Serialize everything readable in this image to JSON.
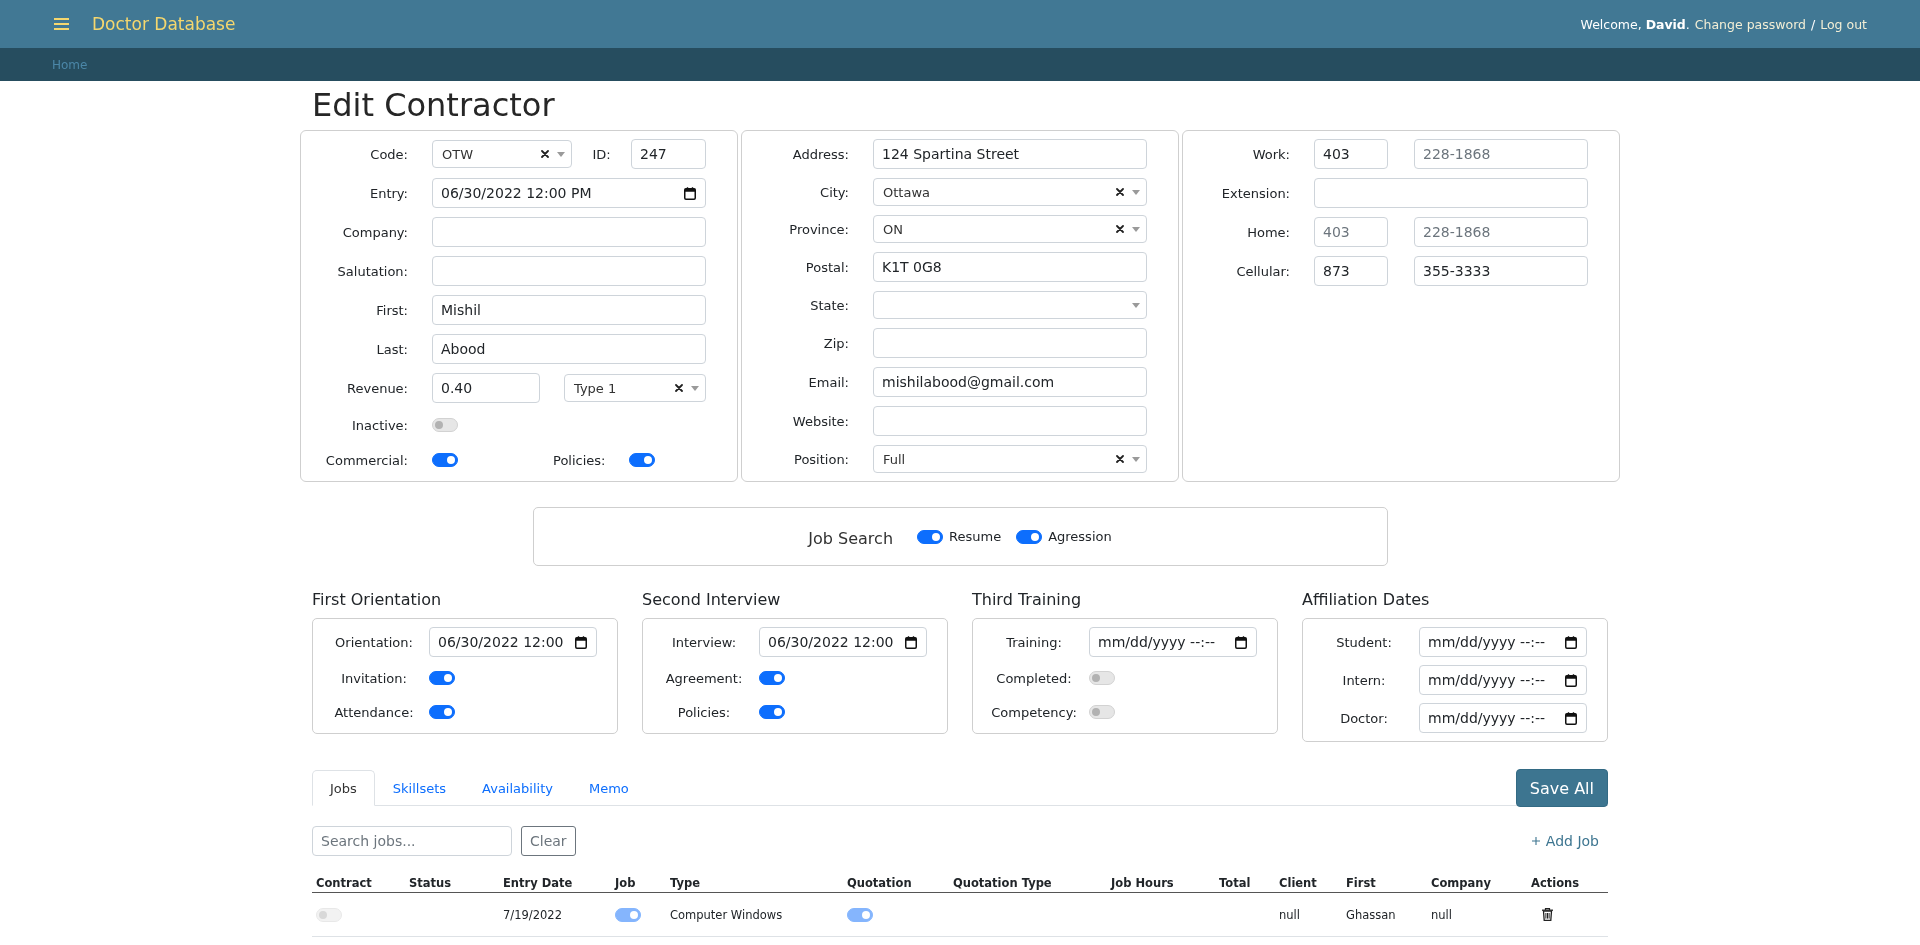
{
  "top_bar": {
    "title": "Doctor Database",
    "user_menu": [
      {
        "kind": "greeting",
        "text": "Welcome, **David**."
      },
      {
        "kind": "link",
        "text": "Change password"
      },
      {
        "kind": "separator",
        "text": "/"
      },
      {
        "kind": "link",
        "text": "Log out"
      }
    ]
  },
  "breadcrumb": [
    "Home"
  ],
  "page_title": "Edit Contractor",
  "main_cards": [
    {
      "rows": [
        {
          "label": "Code:",
          "controls": [
            {
              "kind": "select",
              "value": "OTW",
              "clearable": true
            },
            {
              "kind": "label",
              "text": "ID:"
            },
            {
              "kind": "text",
              "value": "247"
            }
          ]
        },
        {
          "label": "Entry:",
          "controls": [
            {
              "kind": "datetime",
              "value": "06/30/2022 12:00 PM"
            }
          ]
        },
        {
          "label": "Company:",
          "controls": [
            {
              "kind": "text"
            }
          ]
        },
        {
          "label": "Salutation:",
          "controls": [
            {
              "kind": "text"
            }
          ]
        },
        {
          "label": "First:",
          "controls": [
            {
              "kind": "text",
              "value": "Mishil"
            }
          ]
        },
        {
          "label": "Last:",
          "controls": [
            {
              "kind": "text",
              "value": "Abood"
            }
          ]
        },
        {
          "label": "Revenue:",
          "controls": [
            {
              "kind": "text",
              "value": "0.40"
            },
            {
              "kind": "select",
              "value": "Type 1",
              "clearable": true
            }
          ]
        },
        {
          "label": "Inactive:",
          "controls": [
            {
              "kind": "switch",
              "on": false
            }
          ]
        },
        {
          "label": "Commercial:",
          "controls": [
            {
              "kind": "switch",
              "on": true
            },
            {
              "kind": "label",
              "text": "Policies:"
            },
            {
              "kind": "switch",
              "on": true
            }
          ]
        }
      ]
    },
    {
      "rows": [
        {
          "label": "Address:",
          "controls": [
            {
              "kind": "text",
              "value": "124 Spartina Street"
            }
          ]
        },
        {
          "label": "City:",
          "controls": [
            {
              "kind": "select",
              "value": "Ottawa",
              "clearable": true
            }
          ]
        },
        {
          "label": "Province:",
          "controls": [
            {
              "kind": "select",
              "value": "ON",
              "clearable": true
            }
          ]
        },
        {
          "label": "Postal:",
          "controls": [
            {
              "kind": "text",
              "value": "K1T 0G8"
            }
          ]
        },
        {
          "label": "State:",
          "controls": [
            {
              "kind": "select",
              "clearable": false
            }
          ]
        },
        {
          "label": "Zip:",
          "controls": [
            {
              "kind": "text"
            }
          ]
        },
        {
          "label": "Email:",
          "controls": [
            {
              "kind": "text",
              "value": "mishilabood@gmail.com"
            }
          ]
        },
        {
          "label": "Website:",
          "controls": [
            {
              "kind": "text"
            }
          ]
        },
        {
          "label": "Position:",
          "controls": [
            {
              "kind": "select",
              "value": "Full",
              "clearable": true
            }
          ]
        }
      ]
    },
    {
      "rows": [
        {
          "label": "Work:",
          "controls": [
            {
              "kind": "text",
              "value": "403"
            },
            {
              "kind": "text",
              "placeholder": "228-1868"
            }
          ]
        },
        {
          "label": "Extension:",
          "controls": [
            {
              "kind": "text"
            }
          ]
        },
        {
          "label": "Home:",
          "controls": [
            {
              "kind": "text",
              "placeholder": "403"
            },
            {
              "kind": "text",
              "placeholder": "228-1868"
            }
          ]
        },
        {
          "label": "Cellular:",
          "controls": [
            {
              "kind": "text",
              "value": "873"
            },
            {
              "kind": "text",
              "value": "355-3333"
            }
          ]
        }
      ]
    }
  ],
  "job_search": {
    "title": "Job Search",
    "switches": [
      {
        "label": "Resume",
        "on": true
      },
      {
        "label": "Agression",
        "on": true
      }
    ]
  },
  "sections": [
    {
      "title": "First Orientation",
      "rows": [
        {
          "label": "Orientation:",
          "controls": [
            {
              "kind": "datetime",
              "value": "06/30/2022 12:00"
            }
          ]
        },
        {
          "label": "Invitation:",
          "controls": [
            {
              "kind": "switch",
              "on": true
            }
          ]
        },
        {
          "label": "Attendance:",
          "controls": [
            {
              "kind": "switch",
              "on": true
            }
          ]
        }
      ]
    },
    {
      "title": "Second Interview",
      "rows": [
        {
          "label": "Interview:",
          "controls": [
            {
              "kind": "datetime",
              "value": "06/30/2022 12:00"
            }
          ]
        },
        {
          "label": "Agreement:",
          "controls": [
            {
              "kind": "switch",
              "on": true
            }
          ]
        },
        {
          "label": "Policies:",
          "controls": [
            {
              "kind": "switch",
              "on": true
            }
          ]
        }
      ]
    },
    {
      "title": "Third Training",
      "rows": [
        {
          "label": "Training:",
          "controls": [
            {
              "kind": "datetime",
              "placeholder": "mm/dd/yyyy --:--"
            }
          ]
        },
        {
          "label": "Completed:",
          "controls": [
            {
              "kind": "switch",
              "on": false
            }
          ]
        },
        {
          "label": "Competency:",
          "controls": [
            {
              "kind": "switch",
              "on": false
            }
          ]
        }
      ]
    },
    {
      "title": "Affiliation Dates",
      "rows": [
        {
          "label": "Student:",
          "controls": [
            {
              "kind": "datetime",
              "placeholder": "mm/dd/yyyy --:--"
            }
          ]
        },
        {
          "label": "Intern:",
          "controls": [
            {
              "kind": "datetime",
              "placeholder": "mm/dd/yyyy --:--"
            }
          ]
        },
        {
          "label": "Doctor:",
          "controls": [
            {
              "kind": "datetime",
              "placeholder": "mm/dd/yyyy --:--"
            }
          ]
        }
      ]
    }
  ],
  "jobs": {
    "tabs": [
      {
        "label": "Jobs",
        "selected": true
      },
      {
        "label": "Skillsets",
        "selected": false
      },
      {
        "label": "Availability",
        "selected": false
      },
      {
        "label": "Memo",
        "selected": false
      }
    ],
    "save_button": "Save All",
    "search": {
      "placeholder": "Search jobs..."
    },
    "clear_button": "Clear",
    "add_link": "Add Job",
    "table": {
      "columns": [
        "Contract",
        "Status",
        "Entry Date",
        "Job",
        "Type",
        "Quotation",
        "Quotation Type",
        "Job Hours",
        "Total",
        "Client",
        "First",
        "Company",
        "Actions"
      ],
      "rows": [
        {
          "cells": [
            {
              "kind": "switch",
              "on": false,
              "disabled": true
            },
            {
              "kind": "blank"
            },
            {
              "kind": "text",
              "text": "7/19/2022"
            },
            {
              "kind": "switch",
              "on": true,
              "disabled": true
            },
            {
              "kind": "text",
              "text": "Computer Windows"
            },
            {
              "kind": "switch",
              "on": true,
              "disabled": true
            },
            {
              "kind": "blank"
            },
            {
              "kind": "blank"
            },
            {
              "kind": "blank"
            },
            {
              "kind": "text",
              "text": "null"
            },
            {
              "kind": "text",
              "text": "Ghassan"
            },
            {
              "kind": "text",
              "text": "null"
            },
            {
              "kind": "delete"
            }
          ]
        }
      ]
    }
  }
}
